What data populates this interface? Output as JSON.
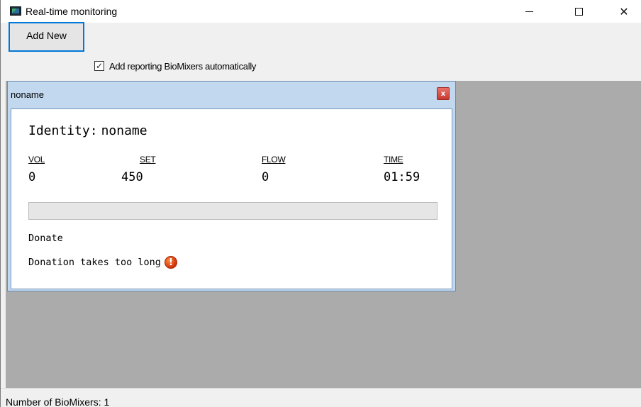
{
  "window": {
    "title": "Real-time monitoring",
    "icon": "monitor-icon",
    "minimize_glyph": "",
    "maximize_glyph": "",
    "close_glyph": "✕"
  },
  "toolbar": {
    "add_new_label": "Add New",
    "auto_add_label": "Add reporting BioMixers automatically",
    "auto_add_checked": true,
    "check_glyph": "✓"
  },
  "child": {
    "title": "noname",
    "close_glyph": "x",
    "identity_label": "Identity:",
    "identity_value": "noname",
    "columns": [
      {
        "label": "VOL",
        "value": "0"
      },
      {
        "label": "SET",
        "value": "450"
      },
      {
        "label": "FLOW",
        "value": "0"
      },
      {
        "label": "TIME",
        "value": "01:59"
      }
    ],
    "progress": 0,
    "status": "Donate",
    "warning": "Donation takes too long",
    "warning_glyph": "!"
  },
  "statusbar": {
    "text": "Number of BioMixers: 1"
  },
  "colors": {
    "accent": "#0078d7",
    "mdi_background": "#ababab",
    "child_frame": "#c1d8ef",
    "warning": "#d1300b"
  }
}
